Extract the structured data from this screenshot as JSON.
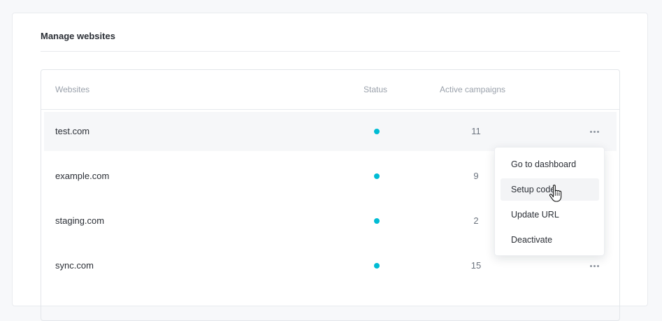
{
  "panel": {
    "title": "Manage websites"
  },
  "table": {
    "headers": {
      "websites": "Websites",
      "status": "Status",
      "campaigns": "Active campaigns"
    },
    "rows": [
      {
        "website": "test.com",
        "status": "active",
        "status_color": "#00bcd4",
        "active_campaigns": "11"
      },
      {
        "website": "example.com",
        "status": "active",
        "status_color": "#00bcd4",
        "active_campaigns": "9"
      },
      {
        "website": "staging.com",
        "status": "active",
        "status_color": "#00bcd4",
        "active_campaigns": "2"
      },
      {
        "website": "sync.com",
        "status": "active",
        "status_color": "#00bcd4",
        "active_campaigns": "15"
      }
    ]
  },
  "row_menu": {
    "items": [
      {
        "label": "Go to dashboard"
      },
      {
        "label": "Setup code"
      },
      {
        "label": "Update URL"
      },
      {
        "label": "Deactivate"
      }
    ],
    "highlighted_item": "Setup code"
  },
  "icons": {
    "more": "more-horizontal-icon",
    "cursor": "hand-pointer-icon"
  },
  "colors": {
    "status_active": "#00bcd4",
    "background": "#f7f8fa",
    "card": "#ffffff"
  }
}
